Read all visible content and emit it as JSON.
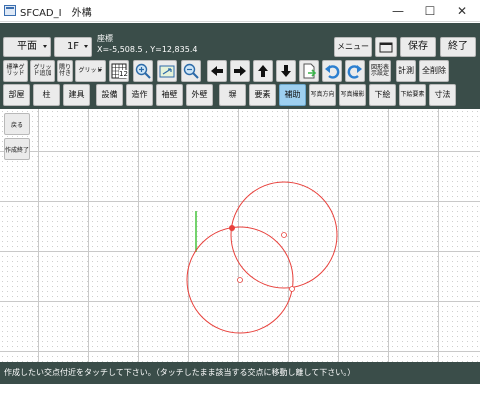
{
  "window": {
    "title": "SFCAD_I　外構",
    "minimize": "—",
    "maximize": "☐",
    "close": "✕"
  },
  "toolbar": {
    "view_select": "平面",
    "floor_select": "1F",
    "coord_label": "座標",
    "coord_value": "X=-5,508.5 , Y=12,835.4",
    "menu_button": "メニュー",
    "save_button": "保存",
    "exit_button": "終了",
    "std_grid": "標準グリッド",
    "add_grid": "グリッド追加",
    "snap": "隅り付き",
    "grid_select": "グリッド",
    "zoom_level": "12",
    "display_settings": "図形表示設定",
    "measure": "計測",
    "delete_all": "全削除",
    "categories": [
      "部屋",
      "柱",
      "建具",
      "設備",
      "造作",
      "袖壁",
      "外壁",
      "塀",
      "要素",
      "補助",
      "写真方向",
      "写真撮影",
      "下絵",
      "下絵要素",
      "寸法"
    ],
    "active_category": "補助"
  },
  "side": {
    "back": "戻る",
    "finish": "作成終了"
  },
  "status": {
    "message": "作成したい交点付近をタッチして下さい。（タッチしたまま該当する交点に移動し離して下さい。）"
  },
  "colors": {
    "toolbar_bg": "#3a4d49",
    "circle": "#e8413c",
    "guide_line": "#44c23a",
    "active_button": "#9ed0f0"
  }
}
